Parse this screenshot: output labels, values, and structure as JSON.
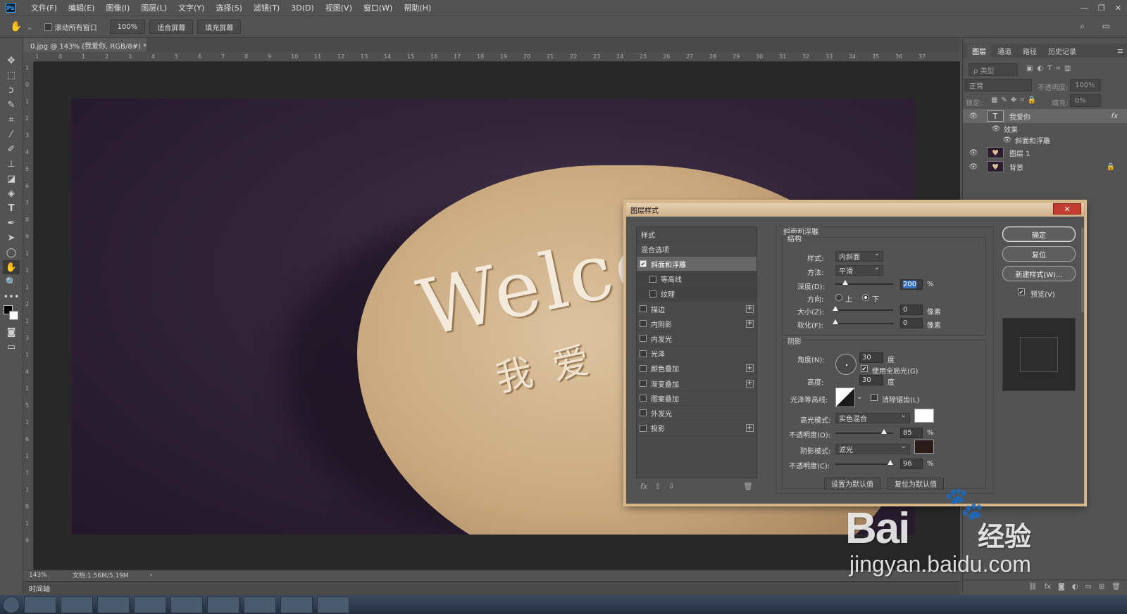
{
  "app": {
    "logo": "Ps"
  },
  "menubar": {
    "items": [
      "文件(F)",
      "编辑(E)",
      "图像(I)",
      "图层(L)",
      "文字(Y)",
      "选择(S)",
      "滤镜(T)",
      "3D(D)",
      "视图(V)",
      "窗口(W)",
      "帮助(H)"
    ]
  },
  "options": {
    "scroll_all": "滚动所有窗口",
    "zoom": "100%",
    "fit_screen": "适合屏幕",
    "fill_screen": "填充屏幕"
  },
  "document": {
    "tab_title": "0.jpg @ 143% (我爱你, RGB/8#) *",
    "close": "×"
  },
  "ruler_top": [
    "1",
    "0",
    "1",
    "2",
    "3",
    "4",
    "5",
    "6",
    "7",
    "8",
    "9",
    "10",
    "11",
    "12",
    "13",
    "14",
    "15",
    "16",
    "17",
    "18",
    "19",
    "20",
    "21",
    "22",
    "23",
    "24",
    "25",
    "26",
    "27",
    "28",
    "29",
    "30",
    "31",
    "32",
    "33",
    "34",
    "35",
    "36",
    "37"
  ],
  "ruler_left": [
    "1",
    "0",
    "1",
    "2",
    "3",
    "4",
    "5",
    "6",
    "7",
    "8",
    "9",
    "1",
    "1",
    "1",
    "2",
    "1",
    "3",
    "1",
    "4",
    "1",
    "5",
    "1",
    "6",
    "1",
    "7",
    "1",
    "8",
    "1",
    "9"
  ],
  "canvas": {
    "welcome": "Welco",
    "chinese": "我爱"
  },
  "status": {
    "zoom": "143%",
    "doc_info": "文档:1.56M/5.19M"
  },
  "timeline": {
    "label": "时间轴"
  },
  "layers_panel": {
    "tabs": [
      "图层",
      "通道",
      "路径",
      "历史记录"
    ],
    "filter_placeholder": "ρ 类型",
    "blend_mode": "正常",
    "opacity_label": "不透明度:",
    "opacity_value": "100%",
    "lock_label": "锁定:",
    "fill_label": "填充:",
    "fill_value": "0%",
    "layers": [
      {
        "name": "我爱你",
        "thumb": "T",
        "fx": "fx"
      },
      {
        "name": "效果"
      },
      {
        "name": "斜面和浮雕"
      },
      {
        "name": "图层 1"
      },
      {
        "name": "背景"
      }
    ]
  },
  "dialog": {
    "title": "图层样式",
    "close": "✕",
    "style_list": [
      {
        "label": "样式",
        "check": false,
        "plus": false
      },
      {
        "label": "混合选项",
        "check": false,
        "plus": false
      },
      {
        "label": "斜面和浮雕",
        "check": true,
        "plus": false
      },
      {
        "label": "等高线",
        "check": false,
        "plus": false
      },
      {
        "label": "纹理",
        "check": false,
        "plus": false
      },
      {
        "label": "描边",
        "check": false,
        "plus": true
      },
      {
        "label": "内阴影",
        "check": false,
        "plus": true
      },
      {
        "label": "内发光",
        "check": false,
        "plus": false
      },
      {
        "label": "光泽",
        "check": false,
        "plus": false
      },
      {
        "label": "颜色叠加",
        "check": false,
        "plus": true
      },
      {
        "label": "渐变叠加",
        "check": false,
        "plus": true
      },
      {
        "label": "图案叠加",
        "check": false,
        "plus": false
      },
      {
        "label": "外发光",
        "check": false,
        "plus": false
      },
      {
        "label": "投影",
        "check": false,
        "plus": true
      }
    ],
    "list_footer": {
      "fx": "fx",
      "up": "⇧",
      "down": "⇩",
      "trash": "🗑"
    },
    "bevel": {
      "section": "斜面和浮雕",
      "structure": "结构",
      "style_label": "样式:",
      "style_value": "内斜面",
      "technique_label": "方法:",
      "technique_value": "平滑",
      "depth_label": "深度(D):",
      "depth_value": "200",
      "depth_unit": "%",
      "direction_label": "方向:",
      "dir_up": "上",
      "dir_down": "下",
      "size_label": "大小(Z):",
      "size_value": "0",
      "size_unit": "像素",
      "soften_label": "软化(F):",
      "soften_value": "0",
      "soften_unit": "像素",
      "shading": "阴影",
      "angle_label": "角度(N):",
      "angle_value": "30",
      "angle_unit": "度",
      "global_light": "使用全局光(G)",
      "altitude_label": "高度:",
      "altitude_value": "30",
      "altitude_unit": "度",
      "gloss_label": "光泽等高线:",
      "antialias": "消除锯齿(L)",
      "highlight_mode_label": "高光模式:",
      "highlight_mode_value": "实色混合",
      "highlight_color": "#ffffff",
      "hl_opacity_label": "不透明度(O):",
      "hl_opacity_value": "85",
      "hl_unit": "%",
      "shadow_mode_label": "阴影模式:",
      "shadow_mode_value": "滤光",
      "shadow_color": "#2a1c1a",
      "sh_opacity_label": "不透明度(C):",
      "sh_opacity_value": "96",
      "sh_unit": "%",
      "make_default": "设置为默认值",
      "reset_default": "复位为默认值"
    },
    "buttons": {
      "ok": "确定",
      "reset": "复位",
      "new_style": "新建样式(W)...",
      "preview": "预览(V)"
    }
  },
  "watermark": {
    "brand": "Bai",
    "brand2": "经验",
    "url": "jingyan.baidu.com"
  }
}
